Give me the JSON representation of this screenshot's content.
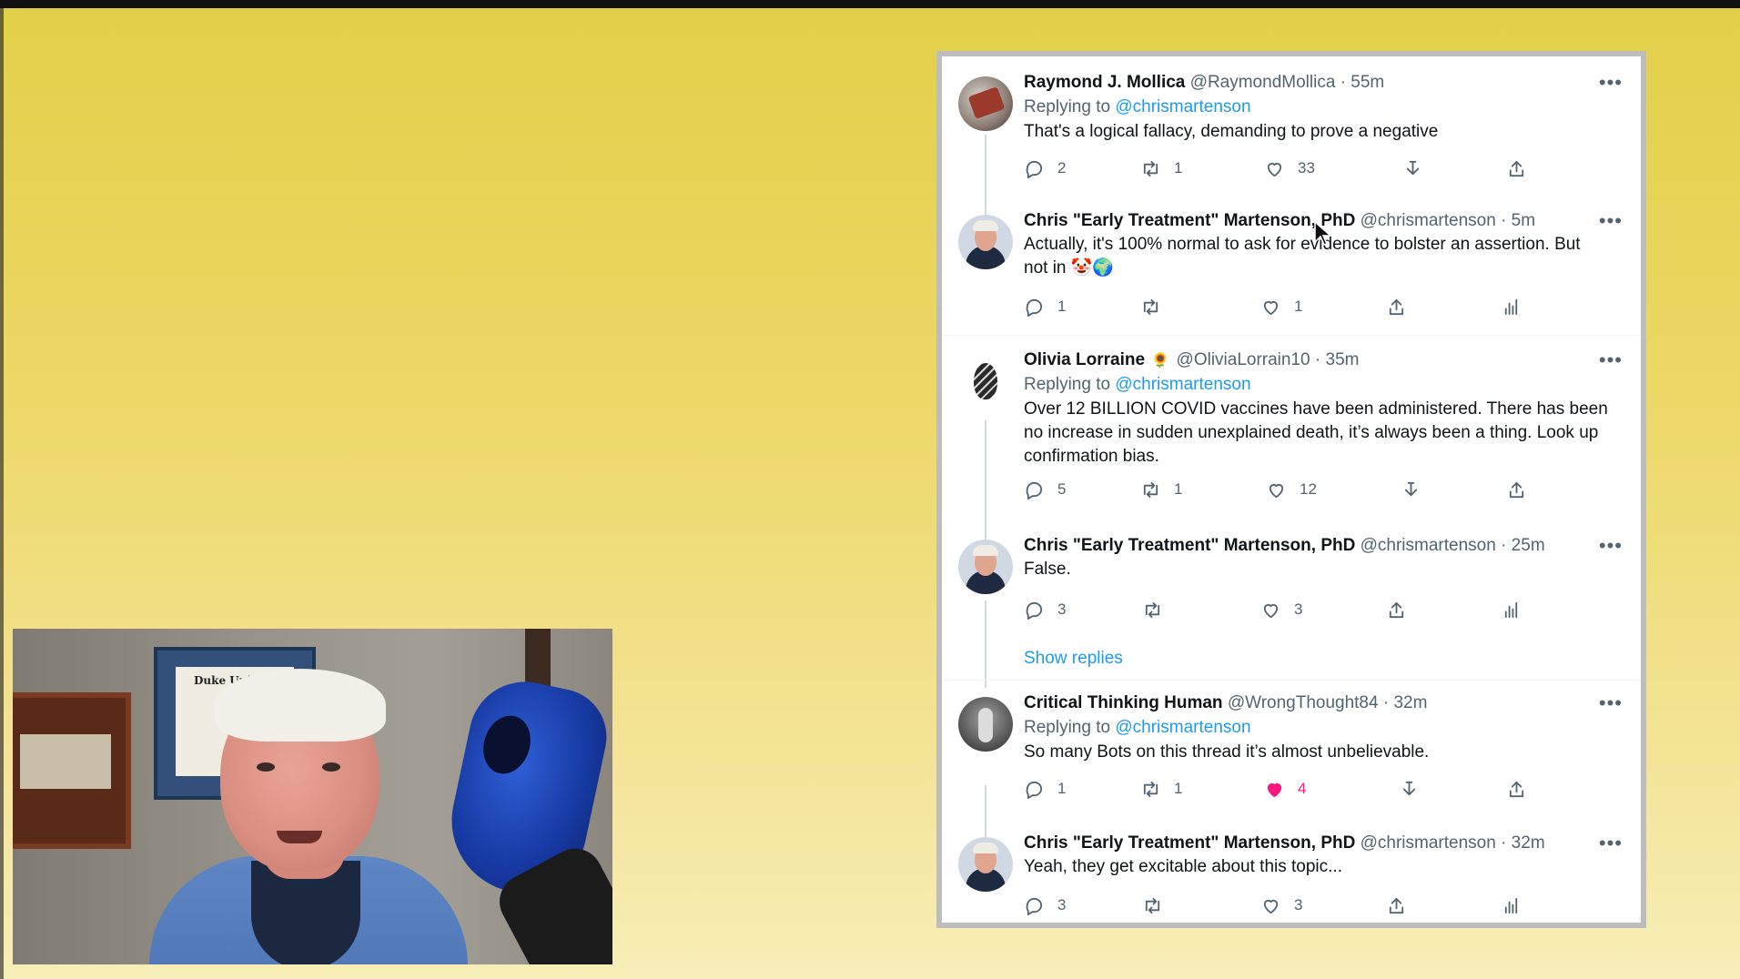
{
  "colors": {
    "accent_blue": "#1d9bf0",
    "like_pink": "#f91880",
    "text": "#0f1419",
    "muted": "#536471"
  },
  "webcam": {
    "diploma_title": "Duke University"
  },
  "tweets": [
    {
      "name": "Raymond J. Mollica",
      "handle": "@RaymondMollica",
      "time": "· 55m",
      "replying_prefix": "Replying to",
      "replying_to": "@chrismartenson",
      "text": "That's a logical fallacy, demanding to prove a negative",
      "reply_count": "2",
      "retweet_count": "1",
      "like_count": "33",
      "actions": [
        "reply-icon",
        "retweet-icon",
        "like-icon",
        "bookmark-icon",
        "share-icon"
      ]
    },
    {
      "name": "Chris \"Early Treatment\" Martenson, PhD",
      "handle": "@chrismartenson",
      "time": "· 5m",
      "text_line1": "Actually, it's 100% normal to ask for evidence to bolster an assertion.  But",
      "text_line2": "not in",
      "emojis": "🤡🌍",
      "reply_count": "1",
      "retweet_count": "",
      "like_count": "1",
      "actions": [
        "reply-icon",
        "retweet-icon",
        "like-icon",
        "share-icon",
        "analytics-icon"
      ]
    },
    {
      "name": "Olivia Lorraine",
      "badge_emoji": "🌻",
      "handle": "@OliviaLorrain10",
      "time": "· 35m",
      "replying_prefix": "Replying to",
      "replying_to": "@chrismartenson",
      "text_line1": "Over 12 BILLION COVID vaccines have been administered. There has been",
      "text_line2": "no increase in sudden unexplained death, it’s always been a thing. Look up",
      "text_line3": "confirmation bias.",
      "reply_count": "5",
      "retweet_count": "1",
      "like_count": "12",
      "actions": [
        "reply-icon",
        "retweet-icon",
        "like-icon",
        "bookmark-icon",
        "share-icon"
      ]
    },
    {
      "name": "Chris \"Early Treatment\" Martenson, PhD",
      "handle": "@chrismartenson",
      "time": "· 25m",
      "text": "False.",
      "reply_count": "3",
      "retweet_count": "",
      "like_count": "3",
      "actions": [
        "reply-icon",
        "retweet-icon",
        "like-icon",
        "share-icon",
        "analytics-icon"
      ]
    },
    {
      "name": "Critical Thinking Human",
      "handle": "@WrongThought84",
      "time": "· 32m",
      "replying_prefix": "Replying to",
      "replying_to": "@chrismartenson",
      "text": "So many Bots on this thread it’s almost unbelievable.",
      "reply_count": "1",
      "retweet_count": "1",
      "like_count": "4",
      "liked": true,
      "actions": [
        "reply-icon",
        "retweet-icon",
        "like-icon",
        "bookmark-icon",
        "share-icon"
      ]
    },
    {
      "name": "Chris \"Early Treatment\" Martenson, PhD",
      "handle": "@chrismartenson",
      "time": "· 32m",
      "text": "Yeah, they get excitable about this topic...",
      "reply_count": "3",
      "retweet_count": "",
      "like_count": "3",
      "actions": [
        "reply-icon",
        "retweet-icon",
        "like-icon",
        "share-icon",
        "analytics-icon"
      ]
    }
  ],
  "show_replies": "Show replies",
  "more_glyph": "•••"
}
